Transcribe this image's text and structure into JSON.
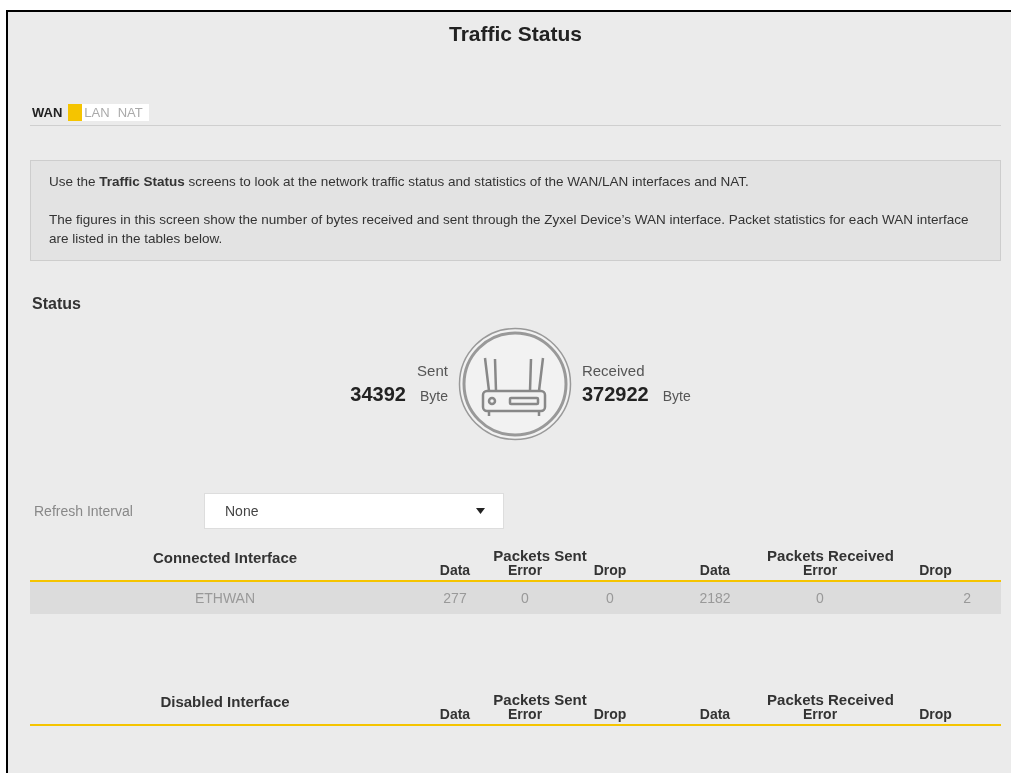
{
  "title": "Traffic Status",
  "tabs": [
    {
      "label": "WAN",
      "selected": true
    },
    {
      "label": "LAN",
      "selected": false
    },
    {
      "label": "NAT",
      "selected": false
    }
  ],
  "intro": [
    "Use the **Traffic Status** screens to look at the network traffic status and statistics of the WAN/LAN interfaces and NAT.",
    "The figures in this screen show the number of bytes received and sent through the Zyxel Device’s WAN interface. Packet statistics for each WAN interface are listed in the tables below."
  ],
  "status": {
    "heading": "Status",
    "sent": {
      "label": "Sent",
      "value": "34392",
      "unit": "Byte"
    },
    "received": {
      "label": "Received",
      "value": "372922",
      "unit": "Byte"
    }
  },
  "refresh": {
    "label": "Refresh Interval",
    "value": "None"
  },
  "tables": [
    {
      "title": "Connected Interface",
      "groups": [
        {
          "label": "Packets Sent",
          "columns": [
            "Data",
            "Error",
            "Drop"
          ]
        },
        {
          "label": "Packets Received",
          "columns": [
            "Data",
            "Error",
            "Drop"
          ]
        }
      ],
      "rows": [
        [
          "ETHWAN",
          "277",
          "0",
          "0",
          "2182",
          "0",
          "2"
        ]
      ]
    },
    {
      "title": "Disabled Interface",
      "groups": [
        {
          "label": "Packets Sent",
          "columns": [
            "Data",
            "Error",
            "Drop"
          ]
        },
        {
          "label": "Packets Received",
          "columns": [
            "Data",
            "Error",
            "Drop"
          ]
        }
      ]
    }
  ]
}
